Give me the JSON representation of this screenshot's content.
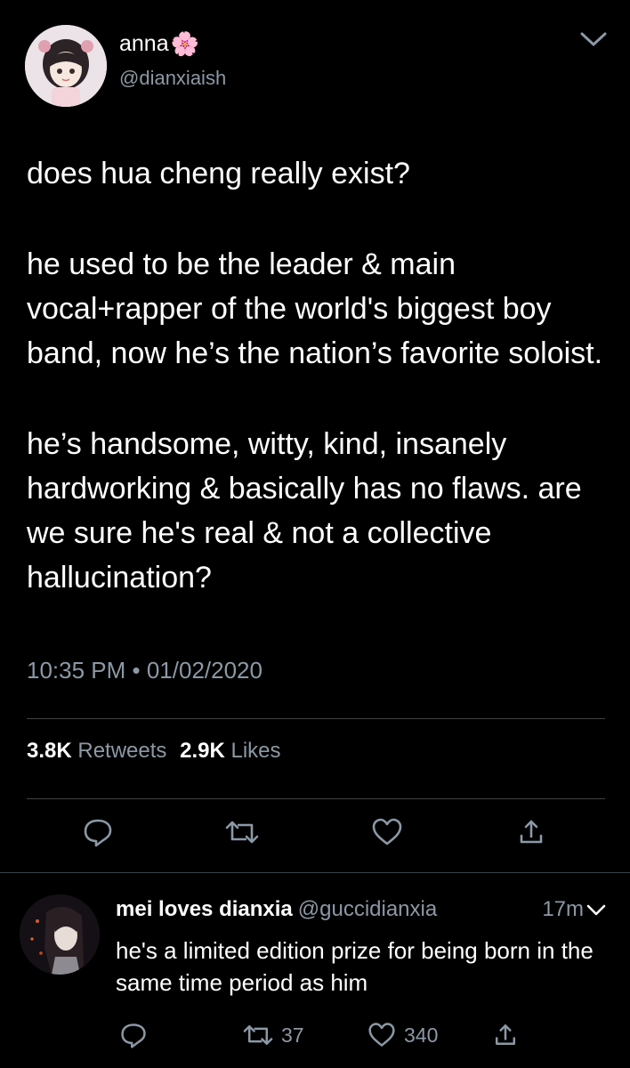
{
  "tweet": {
    "display_name": "anna",
    "name_emoji": "🌸",
    "handle": "@dianxiaish",
    "paragraphs": [
      "does hua cheng really exist?",
      "he used to be the leader & main vocal+rapper of the world's biggest boy band, now he’s the nation’s favorite soloist.",
      "he’s handsome, witty, kind, insanely hardworking & basically has no flaws. are we sure he's real & not a collective hallucination?"
    ],
    "timestamp": "10:35 PM • 01/02/2020",
    "retweets_count": "3.8K",
    "retweets_label": "Retweets",
    "likes_count": "2.9K",
    "likes_label": "Likes",
    "icons": [
      "reply-icon",
      "retweet-icon",
      "like-icon",
      "share-icon",
      "chevron-down-icon"
    ]
  },
  "reply": {
    "display_name": "mei loves dianxia",
    "handle": "@guccidianxia",
    "time": "17m",
    "text": "he's a limited edition prize for being born in the same time period as him",
    "retweet_count": "37",
    "like_count": "340"
  },
  "colors": {
    "background": "#000000",
    "text": "#ffffff",
    "secondary": "#8b98a5",
    "divider": "#38444d"
  }
}
